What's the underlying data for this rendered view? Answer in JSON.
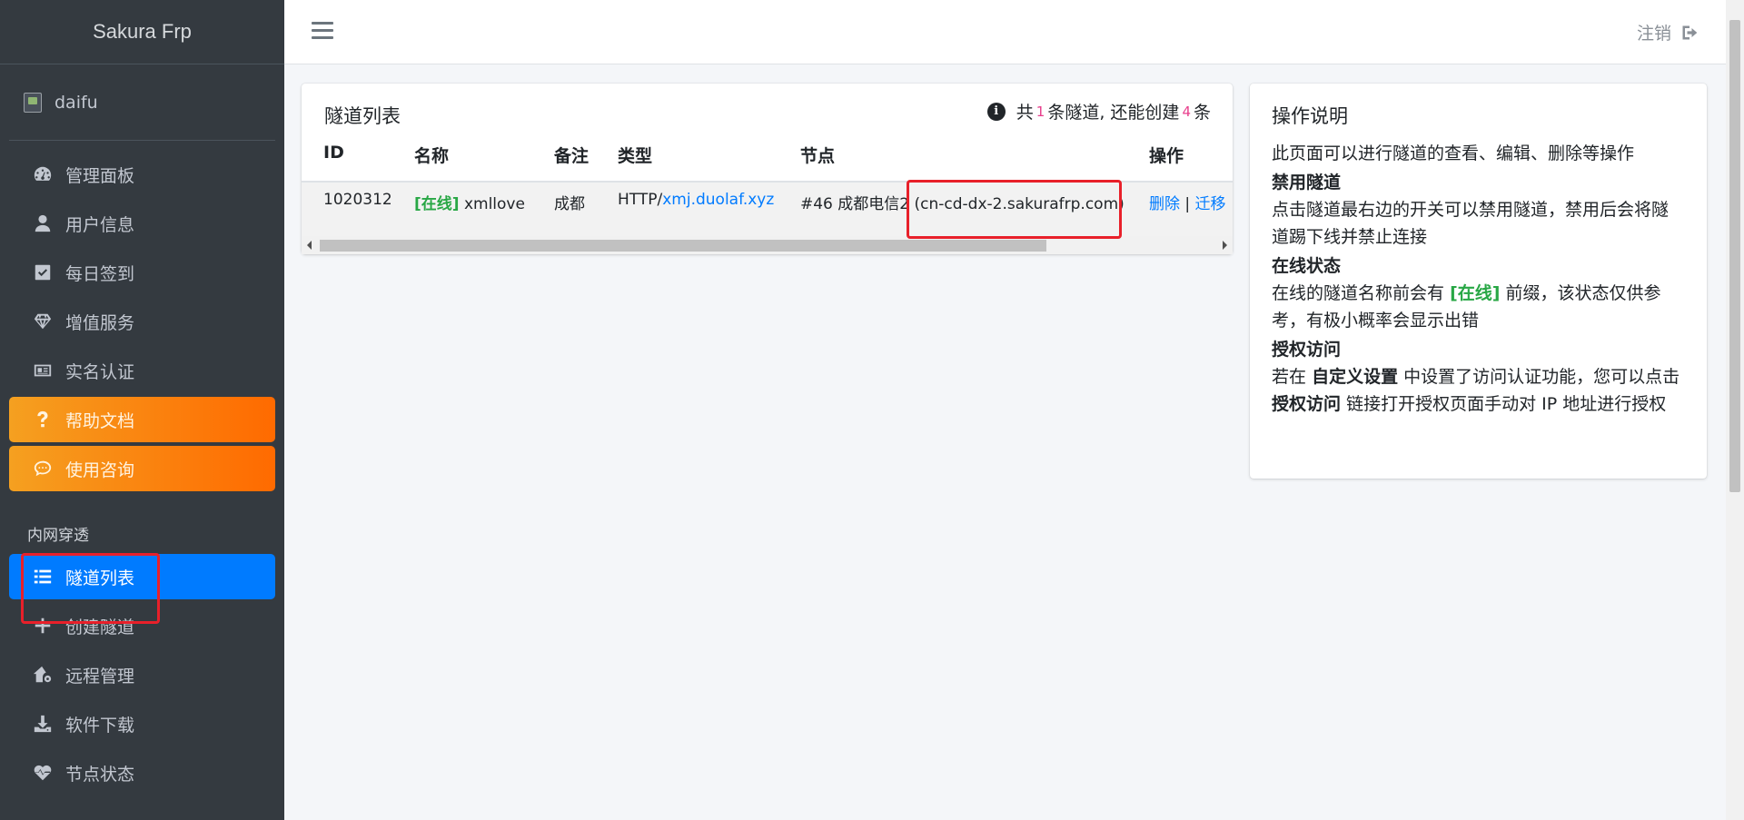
{
  "brand": "Sakura Frp",
  "user": {
    "name": "daifu"
  },
  "nav": {
    "items": [
      {
        "label": "管理面板",
        "icon": "dashboard-icon"
      },
      {
        "label": "用户信息",
        "icon": "user-icon"
      },
      {
        "label": "每日签到",
        "icon": "check-square-icon"
      },
      {
        "label": "增值服务",
        "icon": "gem-icon"
      },
      {
        "label": "实名认证",
        "icon": "id-card-icon"
      },
      {
        "label": "帮助文档",
        "icon": "question-icon"
      },
      {
        "label": "使用咨询",
        "icon": "comment-icon"
      }
    ],
    "section_header": "内网穿透",
    "section_items": [
      {
        "label": "隧道列表",
        "icon": "list-icon"
      },
      {
        "label": "创建隧道",
        "icon": "plus-icon"
      },
      {
        "label": "远程管理",
        "icon": "home-gear-icon"
      },
      {
        "label": "软件下载",
        "icon": "download-icon"
      },
      {
        "label": "节点状态",
        "icon": "heartbeat-icon"
      }
    ]
  },
  "topbar": {
    "logout_label": "注销"
  },
  "tunnels": {
    "title": "隧道列表",
    "info": {
      "prefix": "共",
      "count": "1",
      "middle": "条隧道, 还能创建",
      "remaining": "4",
      "suffix": "条"
    },
    "columns": [
      "ID",
      "名称",
      "备注",
      "类型",
      "节点",
      "操作"
    ],
    "rows": [
      {
        "id": "1020312",
        "status": "[在线]",
        "name": "xmllove",
        "note": "成都",
        "type_prefix": "HTTP/",
        "type_domain": "xmj.duolaf.xyz",
        "node_prefix": "#46 成都电信2",
        "node_host": "(cn-cd-dx-2.sakurafrp.com)",
        "action_delete": "删除",
        "action_sep": "|",
        "action_migrate": "迁移"
      }
    ]
  },
  "help": {
    "title": "操作说明",
    "intro": "此页面可以进行隧道的查看、编辑、删除等操作",
    "s1_title": "禁用隧道",
    "s1_text": "点击隧道最右边的开关可以禁用隧道，禁用后会将隧道踢下线并禁止连接",
    "s2_title": "在线状态",
    "s2_pre": "在线的隧道名称前会有",
    "s2_tag": "[在线]",
    "s2_post": "前缀，该状态仅供参考，有极小概率会显示出错",
    "s3_title": "授权访问",
    "s3_a": "若在",
    "s3_b": "自定义设置",
    "s3_c": "中设置了访问认证功能，您可以点击",
    "s3_d": "授权访问",
    "s3_e": "链接打开授权页面手动对 IP 地址进行授权"
  }
}
